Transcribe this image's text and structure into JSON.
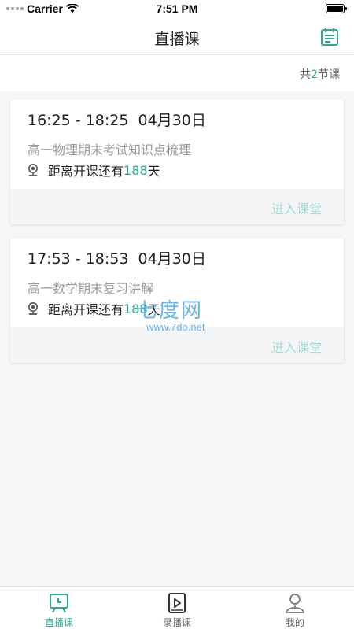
{
  "status_bar": {
    "carrier": "Carrier",
    "time": "7:51 PM"
  },
  "nav": {
    "title": "直播课",
    "calendar_icon": "calendar-icon"
  },
  "summary": {
    "prefix": "共",
    "count": "2",
    "suffix": "节课"
  },
  "lessons": [
    {
      "time": "16:25 - 18:25  04月30日",
      "course": "高一物理期末考试知识点梳理",
      "countdown_prefix": "距离开课还有",
      "days": "188",
      "countdown_suffix": "天",
      "enter_label": "进入课堂"
    },
    {
      "time": "17:53 - 18:53  04月30日",
      "course": "高一数学期末复习讲解",
      "countdown_prefix": "距离开课还有",
      "days": "188",
      "countdown_suffix": "天",
      "enter_label": "进入课堂"
    }
  ],
  "watermark": {
    "logo_text": "七度网",
    "url": "www.7do.net"
  },
  "tabs": [
    {
      "label": "直播课",
      "icon": "live-class-icon",
      "active": true
    },
    {
      "label": "录播课",
      "icon": "recorded-class-icon",
      "active": false
    },
    {
      "label": "我的",
      "icon": "profile-icon",
      "active": false
    }
  ],
  "colors": {
    "accent": "#2bab94",
    "enter_text": "#a3dccf",
    "background": "#f7f7f7"
  }
}
